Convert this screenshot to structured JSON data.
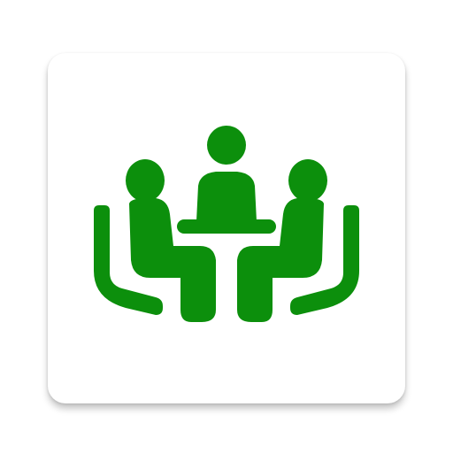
{
  "app_icon": {
    "icon": "meeting-group-icon",
    "background_color": "#ffffff",
    "glyph_color": "#0c8f0c"
  }
}
